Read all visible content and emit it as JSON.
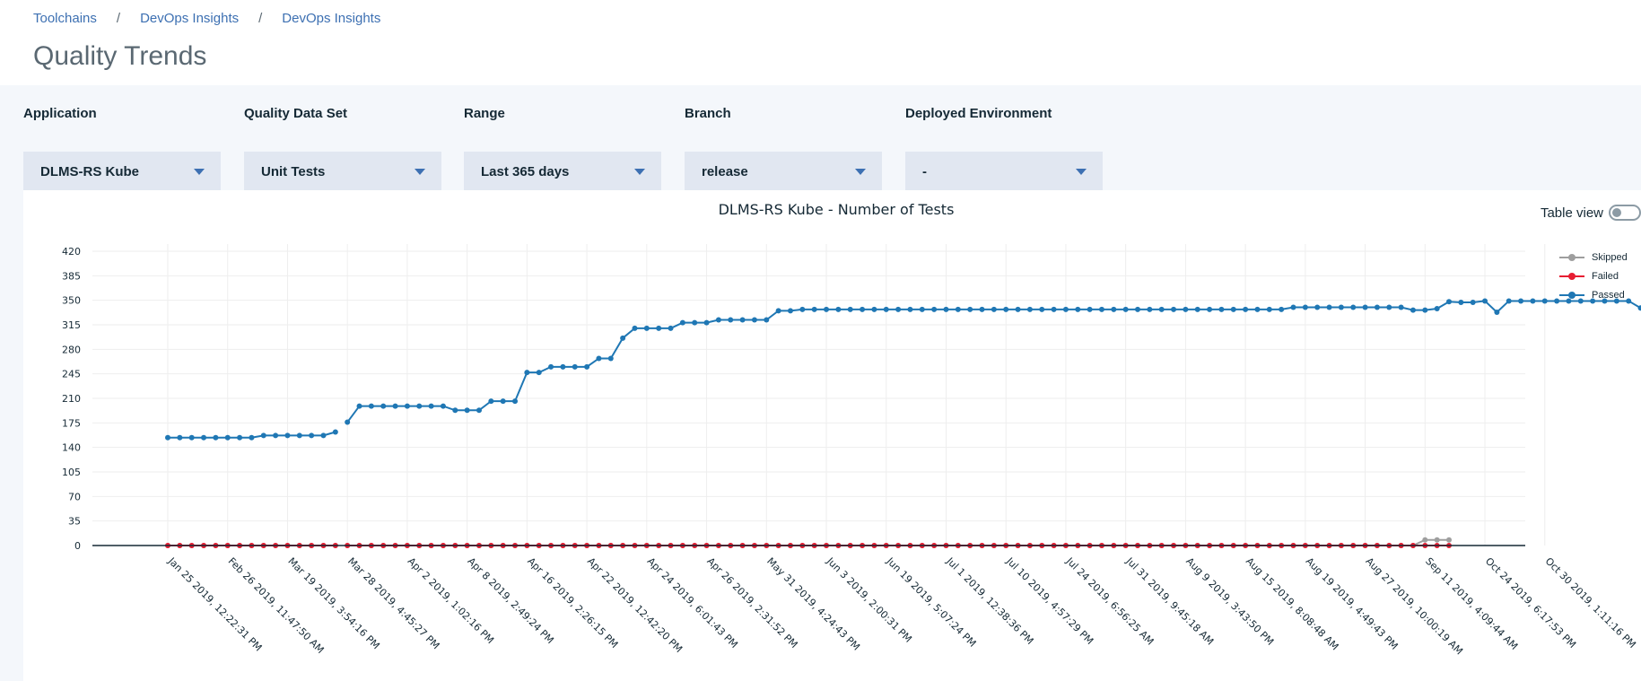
{
  "breadcrumb": [
    "Toolchains",
    "DevOps Insights",
    "DevOps Insights"
  ],
  "page_title": "Quality Trends",
  "filters": [
    {
      "label": "Application",
      "value": "DLMS-RS Kube"
    },
    {
      "label": "Quality Data Set",
      "value": "Unit Tests"
    },
    {
      "label": "Range",
      "value": "Last 365 days"
    },
    {
      "label": "Branch",
      "value": "release"
    },
    {
      "label": "Deployed Environment",
      "value": "-"
    }
  ],
  "table_view_label": "Table view",
  "table_view_on": false,
  "chart_data": {
    "type": "line",
    "title": "DLMS-RS Kube - Number of Tests",
    "ylim": [
      0,
      420
    ],
    "yticks": [
      0,
      35,
      70,
      105,
      140,
      175,
      210,
      245,
      280,
      315,
      350,
      385,
      420
    ],
    "legend_position": "top-right",
    "grid": true,
    "xtick_labels": [
      "Jan 25 2019, 12:22:31 PM",
      "Feb 26 2019, 11:47:50 AM",
      "Mar 19 2019, 3:54:16 PM",
      "Mar 28 2019, 4:45:27 PM",
      "Apr 2 2019, 1:02:16 PM",
      "Apr 8 2019, 2:49:24 PM",
      "Apr 16 2019, 2:26:15 PM",
      "Apr 22 2019, 12:42:20 PM",
      "Apr 24 2019, 6:01:43 PM",
      "Apr 26 2019, 2:31:52 PM",
      "May 31 2019, 4:24:43 PM",
      "Jun 3 2019, 2:00:31 PM",
      "Jun 19 2019, 5:07:24 PM",
      "Jul 1 2019, 12:38:36 PM",
      "Jul 10 2019, 4:57:29 PM",
      "Jul 24 2019, 6:56:25 AM",
      "Jul 31 2019, 9:45:18 AM",
      "Aug 9 2019, 3:43:50 PM",
      "Aug 15 2019, 8:08:48 AM",
      "Aug 19 2019, 4:49:43 PM",
      "Aug 27 2019, 10:00:19 AM",
      "Sep 11 2019, 4:09:44 AM",
      "Oct 24 2019, 6:17:53 PM",
      "Oct 30 2019, 1:11:16 PM"
    ],
    "gap_after_index": 14,
    "series": [
      {
        "name": "Skipped",
        "color": "#9e9e9e",
        "values": [
          0,
          0,
          0,
          0,
          0,
          0,
          0,
          0,
          0,
          0,
          0,
          0,
          0,
          0,
          0,
          0,
          0,
          0,
          0,
          0,
          0,
          0,
          0,
          0,
          0,
          0,
          0,
          0,
          0,
          0,
          0,
          0,
          0,
          0,
          0,
          0,
          0,
          0,
          0,
          0,
          0,
          0,
          0,
          0,
          0,
          0,
          0,
          0,
          0,
          0,
          0,
          0,
          0,
          0,
          0,
          0,
          0,
          0,
          0,
          0,
          0,
          0,
          0,
          0,
          0,
          0,
          0,
          0,
          0,
          0,
          0,
          0,
          0,
          0,
          0,
          0,
          0,
          0,
          0,
          0,
          0,
          0,
          0,
          0,
          0,
          0,
          0,
          0,
          0,
          0,
          0,
          0,
          0,
          0,
          0,
          0,
          0,
          0,
          0,
          0,
          0,
          0,
          0,
          0,
          0,
          8,
          8,
          8
        ]
      },
      {
        "name": "Failed",
        "color": "#e71d32",
        "values": [
          0,
          0,
          0,
          0,
          0,
          0,
          0,
          0,
          0,
          0,
          0,
          0,
          0,
          0,
          0,
          0,
          0,
          0,
          0,
          0,
          0,
          0,
          0,
          0,
          0,
          0,
          0,
          0,
          0,
          0,
          0,
          0,
          0,
          0,
          0,
          0,
          0,
          0,
          0,
          0,
          0,
          0,
          0,
          0,
          0,
          0,
          0,
          0,
          0,
          0,
          0,
          0,
          0,
          0,
          0,
          0,
          0,
          0,
          0,
          0,
          0,
          0,
          0,
          0,
          0,
          0,
          0,
          0,
          0,
          0,
          0,
          0,
          0,
          0,
          0,
          0,
          0,
          0,
          0,
          0,
          0,
          0,
          0,
          0,
          0,
          0,
          0,
          0,
          0,
          0,
          0,
          0,
          0,
          0,
          0,
          0,
          0,
          0,
          0,
          0,
          0,
          0,
          0,
          0,
          0,
          0,
          0,
          0
        ]
      },
      {
        "name": "Passed",
        "color": "#1f77b4",
        "values": [
          154,
          154,
          154,
          154,
          154,
          154,
          154,
          154,
          157,
          157,
          157,
          157,
          157,
          157,
          162,
          176,
          199,
          199,
          199,
          199,
          199,
          199,
          199,
          199,
          193,
          193,
          193,
          206,
          206,
          206,
          247,
          247,
          255,
          255,
          255,
          255,
          267,
          267,
          296,
          310,
          310,
          310,
          310,
          318,
          318,
          318,
          322,
          322,
          322,
          322,
          322,
          335,
          335,
          337,
          337,
          337,
          337,
          337,
          337,
          337,
          337,
          337,
          337,
          337,
          337,
          337,
          337,
          337,
          337,
          337,
          337,
          337,
          337,
          337,
          337,
          337,
          337,
          337,
          337,
          337,
          337,
          337,
          337,
          337,
          337,
          337,
          337,
          337,
          337,
          337,
          337,
          337,
          337,
          337,
          340,
          340,
          340,
          340,
          340,
          340,
          340,
          340,
          340,
          340,
          336,
          336,
          338,
          348,
          347,
          347,
          349,
          333,
          349,
          349,
          349,
          349,
          349,
          349,
          349,
          349,
          349,
          349,
          349,
          339,
          339,
          339
        ]
      }
    ]
  }
}
